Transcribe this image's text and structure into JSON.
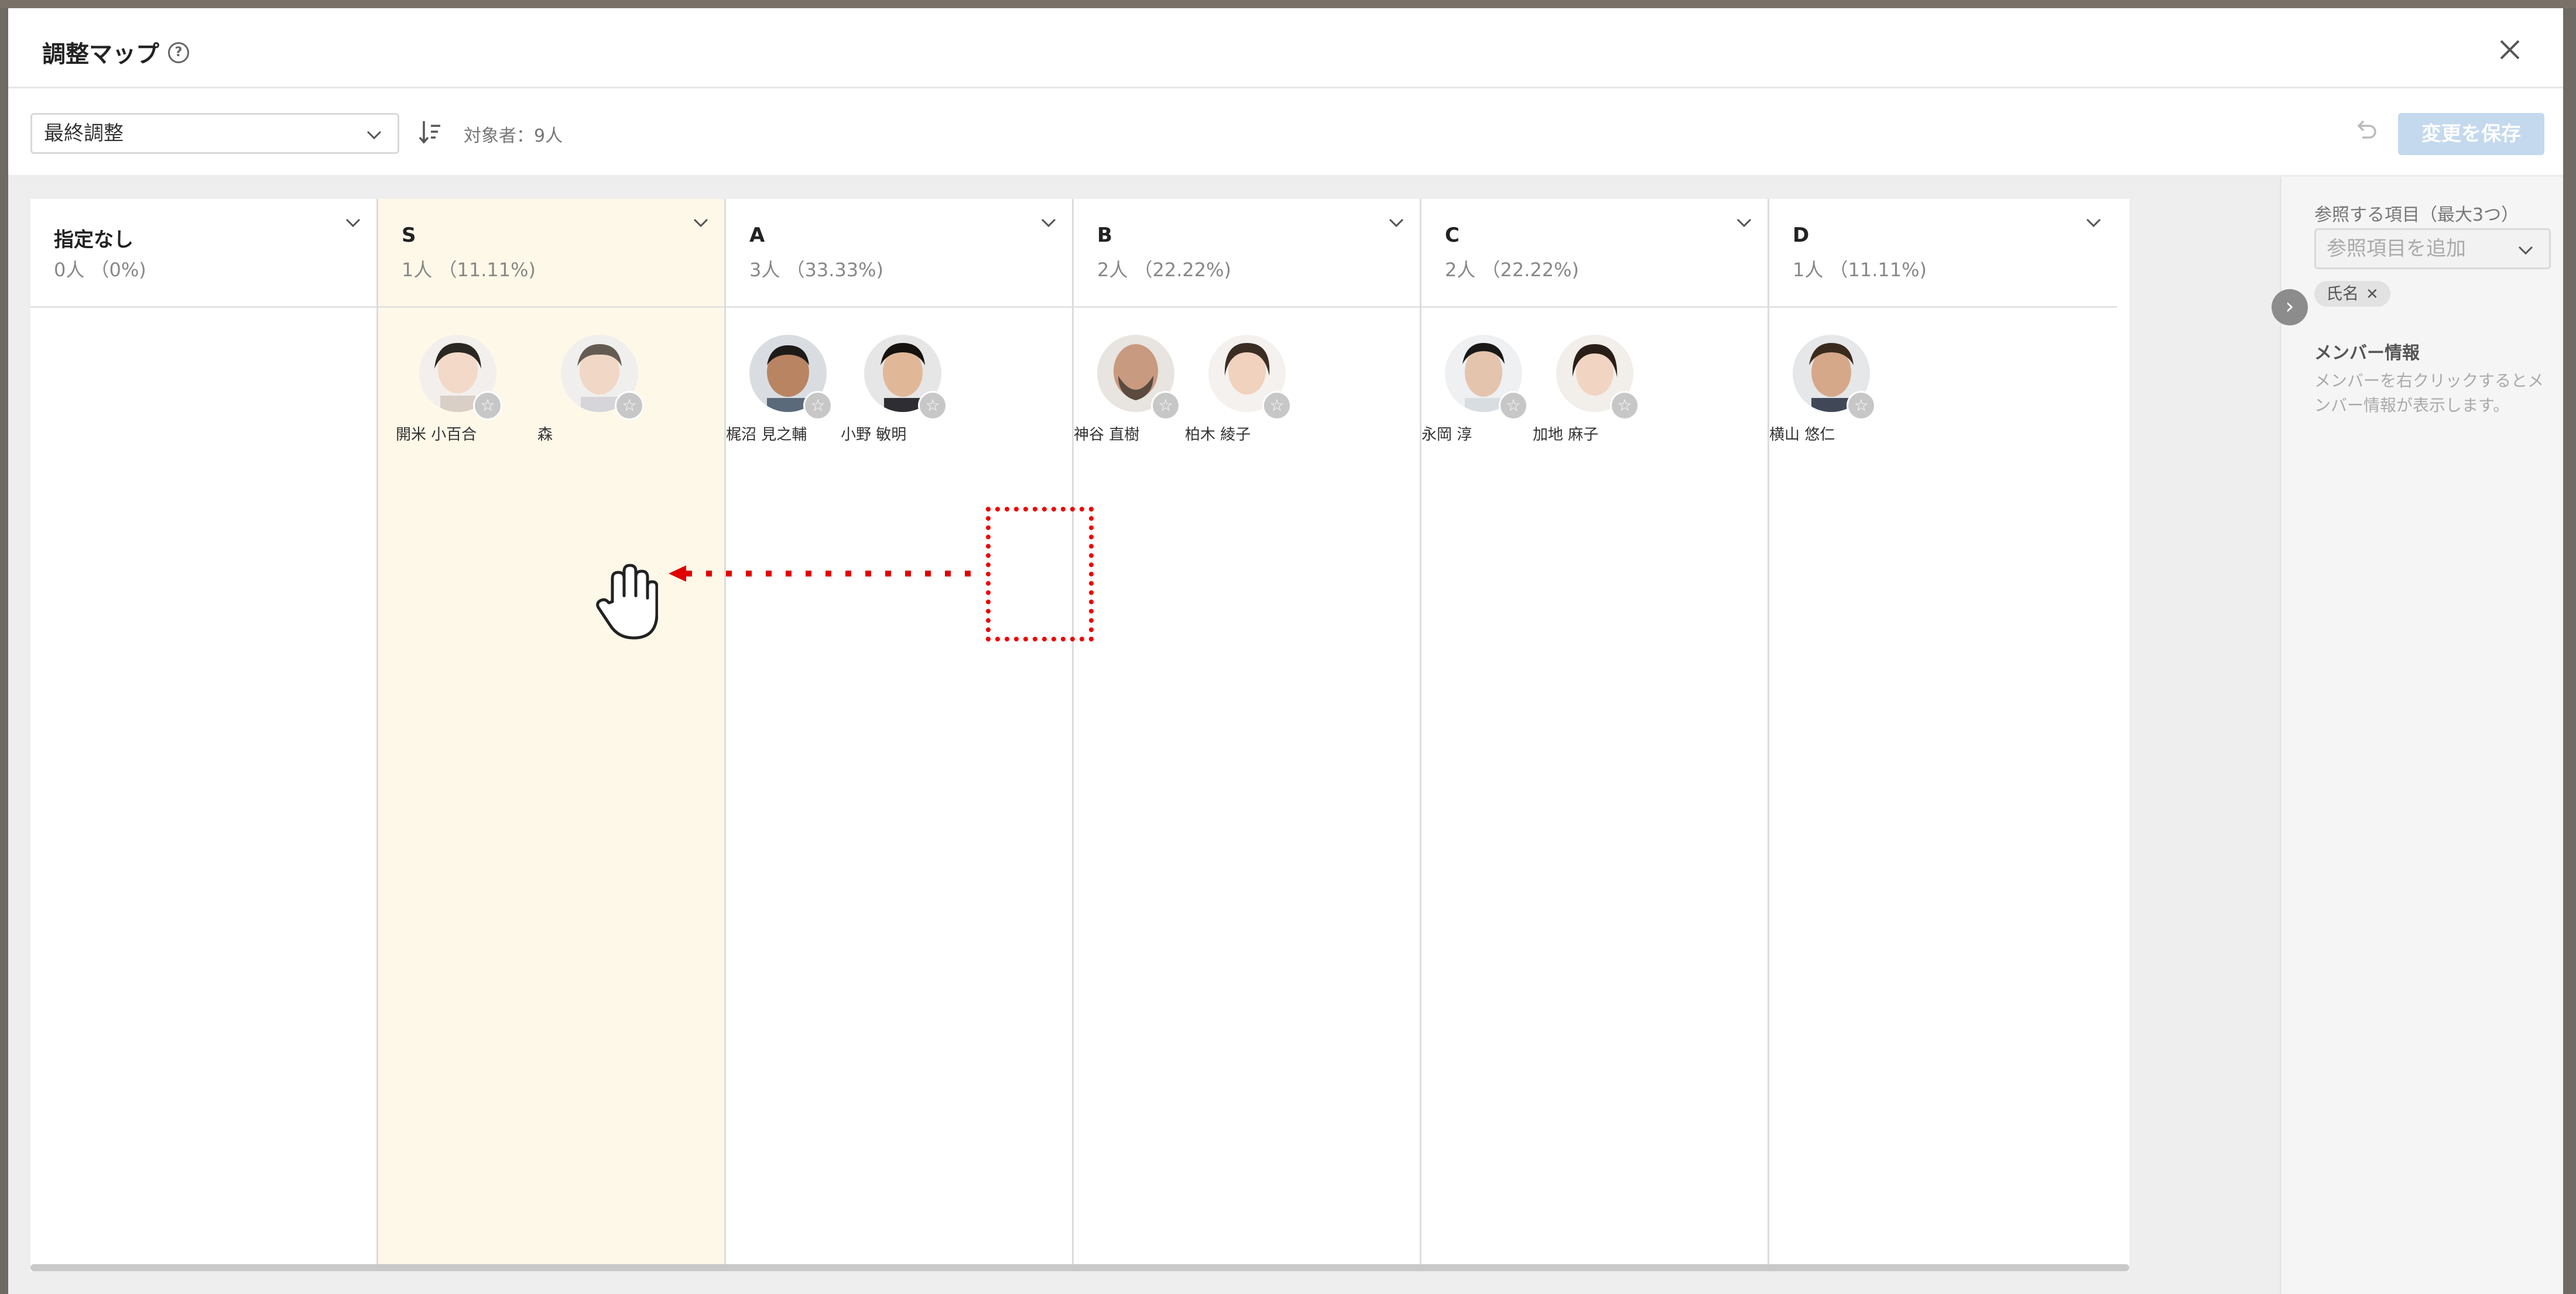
{
  "modal": {
    "title": "調整マップ"
  },
  "toolbar": {
    "select_value": "最終調整",
    "count_label": "対象者：9人",
    "save_label": "変更を保存"
  },
  "columns": [
    {
      "name": "指定なし",
      "count": "0人 （0%)"
    },
    {
      "name": "S",
      "count": "1人 （11.11%)"
    },
    {
      "name": "A",
      "count": "3人 （33.33%)"
    },
    {
      "name": "B",
      "count": "2人 （22.22%)"
    },
    {
      "name": "C",
      "count": "2人 （22.22%)"
    },
    {
      "name": "D",
      "count": "1人 （11.11%)"
    }
  ],
  "members": [
    {
      "name": "開米 小百合"
    },
    {
      "name": "森"
    },
    {
      "name": "梶沼 見之輔"
    },
    {
      "name": "小野 敏明"
    },
    {
      "name": "神谷 直樹"
    },
    {
      "name": "柏木 綾子"
    },
    {
      "name": "永岡 淳"
    },
    {
      "name": "加地 麻子"
    },
    {
      "name": "横山 悠仁"
    }
  ],
  "right_panel": {
    "ref_label": "参照する項目（最大3つ）",
    "ref_placeholder": "参照項目を追加",
    "chip_label": "氏名",
    "info_title": "メンバー情報",
    "info_text": "メンバーを右クリックするとメンバー情報が表示します。"
  },
  "colors": {
    "highlight_column": "#fef8e8",
    "save_button": "#c4d9ee",
    "drag_indicator": "#e00000"
  }
}
